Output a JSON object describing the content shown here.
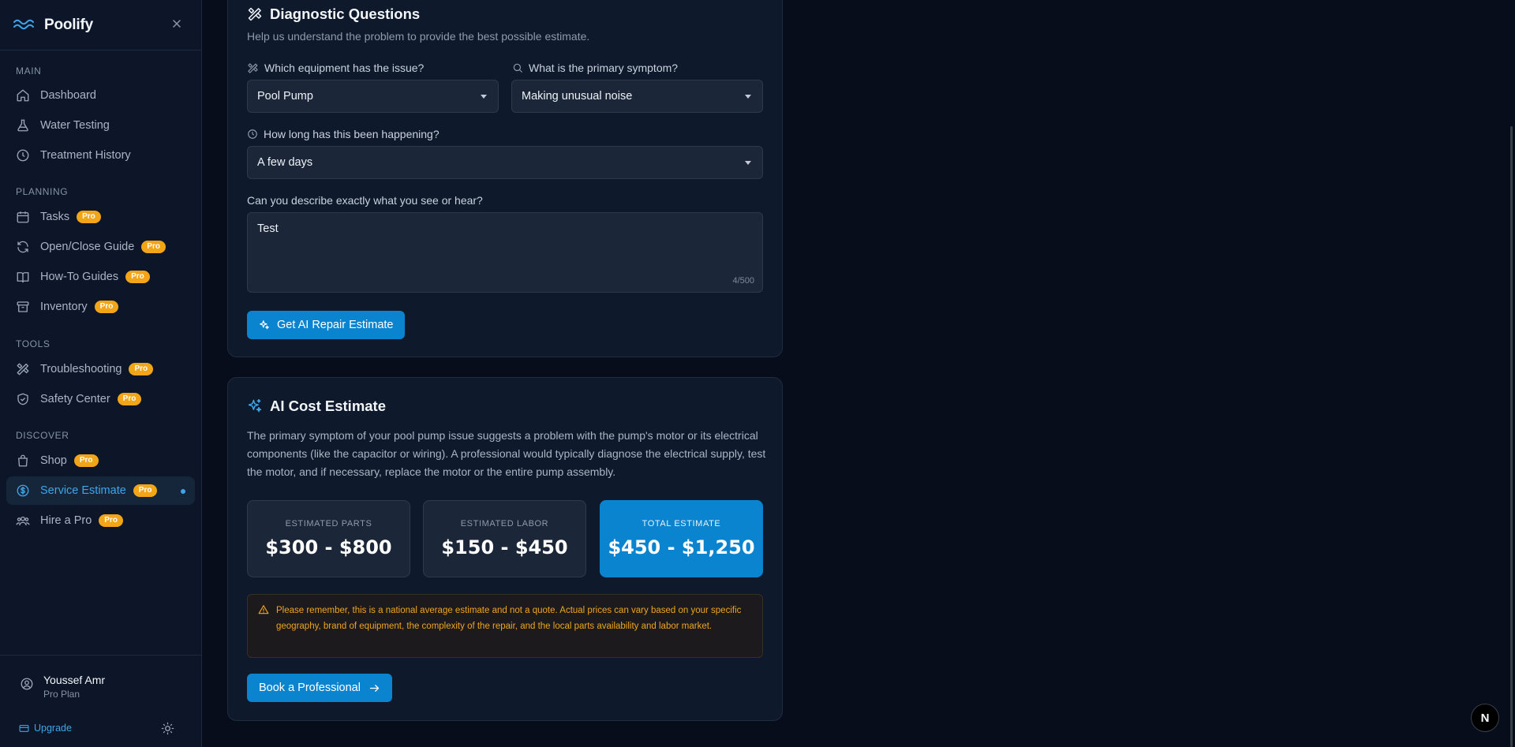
{
  "brand": {
    "name": "Poolify"
  },
  "sidebar": {
    "sections": {
      "main": "MAIN",
      "planning": "PLANNING",
      "tools": "TOOLS",
      "discover": "DISCOVER"
    },
    "items": [
      {
        "label": "Dashboard",
        "icon": "home-icon"
      },
      {
        "label": "Water Testing",
        "icon": "flask-icon"
      },
      {
        "label": "Treatment History",
        "icon": "clock-icon"
      },
      {
        "label": "Tasks",
        "icon": "calendar-icon",
        "badge": "Pro"
      },
      {
        "label": "Open/Close Guide",
        "icon": "refresh-icon",
        "badge": "Pro"
      },
      {
        "label": "How-To Guides",
        "icon": "book-icon",
        "badge": "Pro"
      },
      {
        "label": "Inventory",
        "icon": "archive-icon",
        "badge": "Pro"
      },
      {
        "label": "Troubleshooting",
        "icon": "tools-icon",
        "badge": "Pro"
      },
      {
        "label": "Safety Center",
        "icon": "shield-check-icon",
        "badge": "Pro"
      },
      {
        "label": "Shop",
        "icon": "shopping-bag-icon",
        "badge": "Pro"
      },
      {
        "label": "Service Estimate",
        "icon": "dollar-circle-icon",
        "badge": "Pro",
        "active": true
      },
      {
        "label": "Hire a Pro",
        "icon": "users-icon",
        "badge": "Pro"
      }
    ],
    "user": {
      "name": "Youssef Amr",
      "plan": "Pro Plan"
    },
    "upgrade_label": "Upgrade"
  },
  "diagnostic": {
    "title": "Diagnostic Questions",
    "subtitle": "Help us understand the problem to provide the best possible estimate.",
    "equipment_label": "Which equipment has the issue?",
    "equipment_value": "Pool Pump",
    "symptom_label": "What is the primary symptom?",
    "symptom_value": "Making unusual noise",
    "duration_label": "How long has this been happening?",
    "duration_value": "A few days",
    "describe_label": "Can you describe exactly what you see or hear?",
    "describe_value": "Test",
    "char_counter": "4/500",
    "submit_label": "Get AI Repair Estimate"
  },
  "estimate": {
    "title": "AI Cost Estimate",
    "description": "The primary symptom of your pool pump issue suggests a problem with the pump's motor or its electrical components (like the capacitor or wiring). A professional would typically diagnose the electrical supply, test the motor, and if necessary, replace the motor or the entire pump assembly.",
    "parts_label": "ESTIMATED PARTS",
    "parts_value": "$300 - $800",
    "labor_label": "ESTIMATED LABOR",
    "labor_value": "$150 - $450",
    "total_label": "TOTAL ESTIMATE",
    "total_value": "$450 - $1,250",
    "disclaimer": "Please remember, this is a national average estimate and not a quote. Actual prices can vary based on your specific geography, brand of equipment, the complexity of the repair, and the local parts availability and labor market.",
    "book_label": "Book a Professional"
  },
  "dev_badge": "N",
  "colors": {
    "accent": "#0b84d0",
    "accent_text": "#3ea6e8",
    "pro_badge": "#f2a516",
    "warning": "#f0a51e"
  }
}
